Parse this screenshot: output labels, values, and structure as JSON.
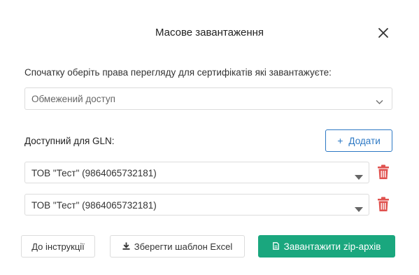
{
  "dialog": {
    "title": "Масове завантаження",
    "close_icon": "close-icon"
  },
  "instruction": "Спочатку оберіть права перегляду для сертифікатів які завантажуєте:",
  "access_select": {
    "value": "Обмежений доступ",
    "icon": "chevron-down-icon"
  },
  "gln": {
    "label": "Доступний для GLN:",
    "add_button": {
      "icon": "plus-icon",
      "label": "Додати"
    },
    "rows": [
      {
        "value": "ТОВ \"Тест\" (9864065732181)",
        "icon": "caret-down-icon",
        "delete_icon": "trash-icon"
      },
      {
        "value": "ТОВ \"Тест\" (9864065732181)",
        "icon": "caret-down-icon",
        "delete_icon": "trash-icon"
      }
    ]
  },
  "footer": {
    "instructions_button": "До інструкції",
    "excel_button": {
      "icon": "download-icon",
      "label": "Зберегти шаблон Excel"
    },
    "zip_button": {
      "icon": "file-icon",
      "label": "Завантажити zip-архів"
    }
  },
  "colors": {
    "accent_blue": "#2c78c4",
    "primary_green": "#1aa77e",
    "danger_red": "#e0524f",
    "border": "#dcdcdc"
  }
}
